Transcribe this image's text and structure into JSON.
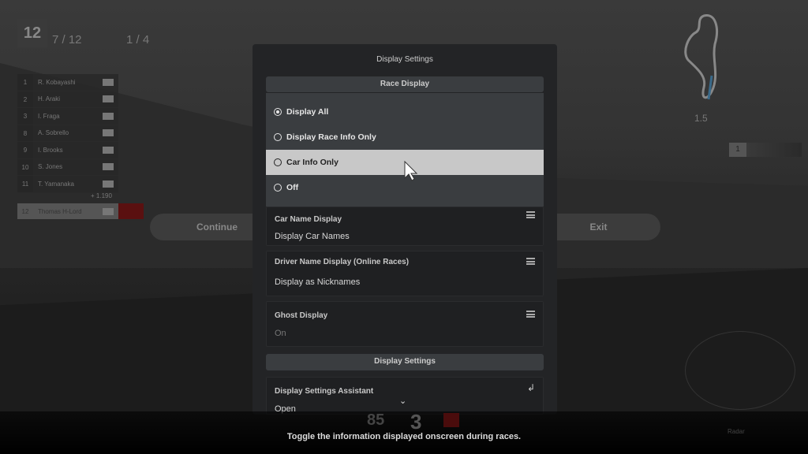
{
  "hud": {
    "position": "12",
    "position_count": "7 / 12",
    "lap_count": "1 / 4",
    "gap": "+ 1.190",
    "distance": "1.5",
    "rank_box": "1",
    "speed": "85",
    "gear": "3",
    "radar_label": "Radar",
    "leaderboard": [
      {
        "pos": "1",
        "name": "R. Kobayashi"
      },
      {
        "pos": "2",
        "name": "H. Araki"
      },
      {
        "pos": "3",
        "name": "I. Fraga"
      },
      {
        "pos": "8",
        "name": "A. Sobrello"
      },
      {
        "pos": "9",
        "name": "I. Brooks"
      },
      {
        "pos": "10",
        "name": "S. Jones"
      },
      {
        "pos": "11",
        "name": "T. Yamanaka"
      }
    ],
    "player": {
      "pos": "12",
      "name": "Thomas H-Lord"
    }
  },
  "pause": {
    "continue_label": "Continue",
    "exit_label": "Exit"
  },
  "panel": {
    "title": "Display Settings",
    "race_display_header": "Race Display",
    "race_display_options": [
      {
        "label": "Display All",
        "selected": true
      },
      {
        "label": "Display Race Info Only",
        "selected": false
      },
      {
        "label": "Car Info Only",
        "selected": false,
        "highlighted": true
      },
      {
        "label": "Off",
        "selected": false
      }
    ],
    "items": [
      {
        "label": "Car Name Display",
        "value": "Display Car Names",
        "icon": "list-icon"
      },
      {
        "label": "Driver Name Display (Online Races)",
        "value": "Display as Nicknames",
        "icon": "list-icon"
      },
      {
        "label": "Ghost Display",
        "value": "On",
        "icon": "list-icon"
      }
    ],
    "display_settings_header": "Display Settings",
    "assistant": {
      "label": "Display Settings Assistant",
      "value": "Open",
      "icon": "enter-icon"
    }
  },
  "hint": "Toggle the information displayed onscreen during races.",
  "colors": {
    "highlight": "#c8c8c8",
    "panel": "#232426",
    "section": "#3a3d40"
  }
}
